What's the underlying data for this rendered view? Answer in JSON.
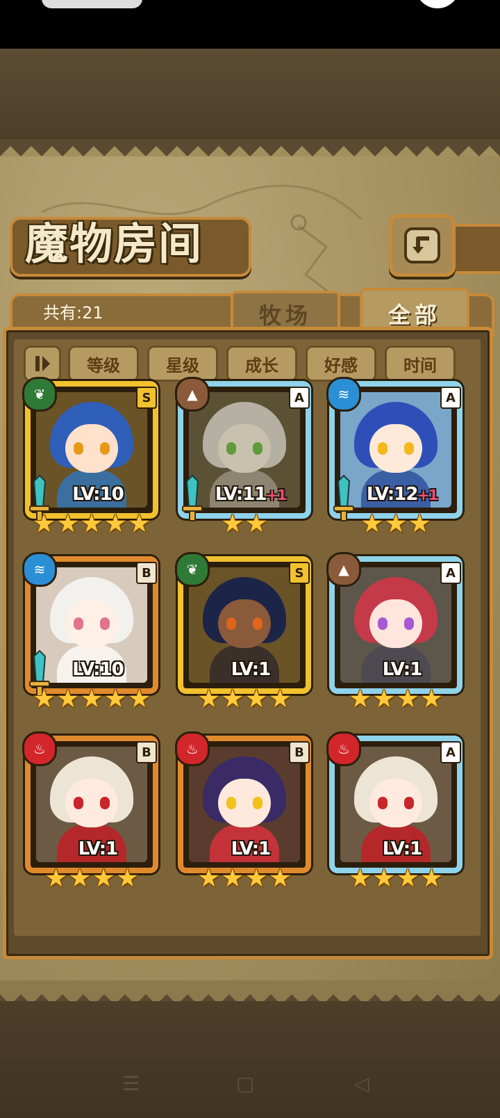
{
  "title": "魔物房间",
  "count_label": "共有:21",
  "tabs": [
    {
      "label": "牧场",
      "active": false
    },
    {
      "label": "全部",
      "active": true
    }
  ],
  "sort_buttons": [
    "等级",
    "星级",
    "成长",
    "好感",
    "时间"
  ],
  "colors": {
    "gold_frame": "#f2c12e",
    "blue_frame": "#8fd3ea",
    "orange_frame": "#e08a2e",
    "star": "#ffc93a",
    "plus": "#ff4b7a"
  },
  "monsters": [
    {
      "rank": "S",
      "element": "leaf",
      "level": "LV:10",
      "plus": "",
      "stars": 5,
      "frame": "gold",
      "weapon": true,
      "hair": "#2f5fb8",
      "eye": "#e59a1a",
      "skin": "#ffe1cc",
      "body": "#3b6fa0",
      "bg": "#6a5326"
    },
    {
      "rank": "A",
      "element": "earth",
      "level": "LV:11",
      "plus": "+1",
      "stars": 2,
      "frame": "blue",
      "weapon": true,
      "hair": "#b6b0a2",
      "eye": "#5f9b3a",
      "skin": "#c8c1ae",
      "body": "#8d8471",
      "bg": "#5b5236"
    },
    {
      "rank": "A",
      "element": "water",
      "level": "LV:12",
      "plus": "+1",
      "stars": 3,
      "frame": "blue",
      "weapon": true,
      "hair": "#2f4fb8",
      "eye": "#f2b81d",
      "skin": "#ffe9d8",
      "body": "#3a5fa5",
      "bg": "#7aa6c9"
    },
    {
      "rank": "B",
      "element": "water",
      "level": "LV:10",
      "plus": "",
      "stars": 5,
      "frame": "orange",
      "weapon": true,
      "hair": "#f3f1ee",
      "eye": "#e2738c",
      "skin": "#fff0e6",
      "body": "#f7f2ee",
      "bg": "#d8cbbd"
    },
    {
      "rank": "S",
      "element": "leaf",
      "level": "LV:1",
      "plus": "",
      "stars": 4,
      "frame": "gold",
      "weapon": false,
      "hair": "#1c2448",
      "eye": "#e0641c",
      "skin": "#8a5a3a",
      "body": "#3b2f2a",
      "bg": "#6a5326"
    },
    {
      "rank": "A",
      "element": "earth",
      "level": "LV:1",
      "plus": "",
      "stars": 4,
      "frame": "blue",
      "weapon": false,
      "hair": "#c43a48",
      "eye": "#a55ad2",
      "skin": "#ffe5dc",
      "body": "#4d4a52",
      "bg": "#5d564b"
    },
    {
      "rank": "B",
      "element": "fire",
      "level": "LV:1",
      "plus": "",
      "stars": 4,
      "frame": "orange",
      "weapon": false,
      "hair": "#ece5d6",
      "eye": "#c8262a",
      "skin": "#ffeadf",
      "body": "#b5282a",
      "bg": "#6d5a45"
    },
    {
      "rank": "B",
      "element": "fire",
      "level": "LV:1",
      "plus": "",
      "stars": 4,
      "frame": "orange",
      "weapon": false,
      "hair": "#3a2a66",
      "eye": "#f0c21a",
      "skin": "#ffe8dc",
      "body": "#c4333a",
      "bg": "#5a3c2e"
    },
    {
      "rank": "A",
      "element": "fire",
      "level": "LV:1",
      "plus": "",
      "stars": 4,
      "frame": "blue",
      "weapon": false,
      "hair": "#ece5d6",
      "eye": "#c8262a",
      "skin": "#ffeadf",
      "body": "#b5282a",
      "bg": "#6d5a45"
    }
  ],
  "nav": [
    "menu-icon",
    "home-icon",
    "back-icon"
  ]
}
